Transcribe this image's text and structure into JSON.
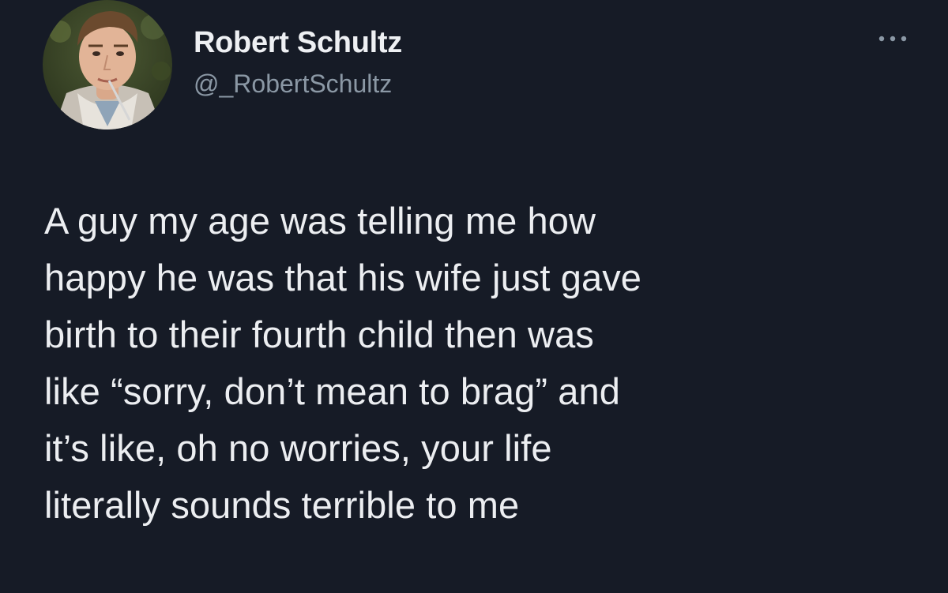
{
  "tweet": {
    "author": {
      "display_name": "Robert Schultz",
      "handle": "@_RobertSchultz",
      "avatar_icon": "profile-photo"
    },
    "more_icon": "more-options-icon",
    "text_lines": [
      "A guy my age was telling me how",
      "happy he was that his wife just gave",
      "birth to their fourth child then was",
      "like “sorry, don’t mean to brag” and",
      "it’s like, oh no worries, your life",
      "literally sounds terrible to me"
    ]
  },
  "colors": {
    "background": "#161b26",
    "primary_text": "#eceef1",
    "secondary_text": "#8b98a5"
  }
}
